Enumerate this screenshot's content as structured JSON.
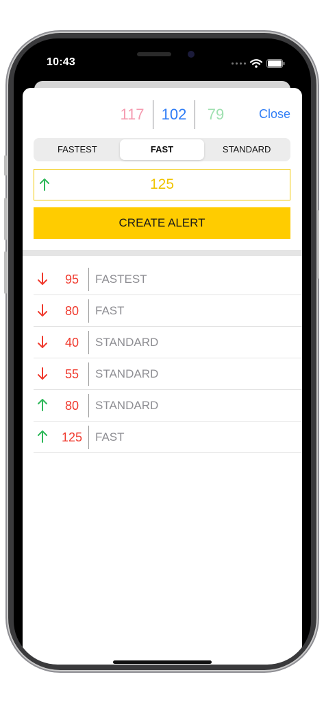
{
  "status_bar": {
    "time": "10:43"
  },
  "prices": [
    {
      "value": "117",
      "color": "#f59bb0"
    },
    {
      "value": "102",
      "color": "#2f7df6"
    },
    {
      "value": "79",
      "color": "#9fe0b0"
    }
  ],
  "close_label": "Close",
  "speed_tabs": [
    {
      "label": "FASTEST",
      "selected": false
    },
    {
      "label": "FAST",
      "selected": true
    },
    {
      "label": "STANDARD",
      "selected": false
    }
  ],
  "alert_input": {
    "direction": "up",
    "value": "125"
  },
  "create_button_label": "CREATE ALERT",
  "alerts": [
    {
      "direction": "down",
      "value": "95",
      "speed": "FASTEST"
    },
    {
      "direction": "down",
      "value": "80",
      "speed": "FAST"
    },
    {
      "direction": "down",
      "value": "40",
      "speed": "STANDARD"
    },
    {
      "direction": "down",
      "value": "55",
      "speed": "STANDARD"
    },
    {
      "direction": "up",
      "value": "80",
      "speed": "STANDARD"
    },
    {
      "direction": "up",
      "value": "125",
      "speed": "FAST"
    }
  ],
  "colors": {
    "accent_yellow": "#ffcc00",
    "link_blue": "#2f7df6",
    "down_red": "#f03a2e",
    "up_green": "#2fb85a"
  }
}
